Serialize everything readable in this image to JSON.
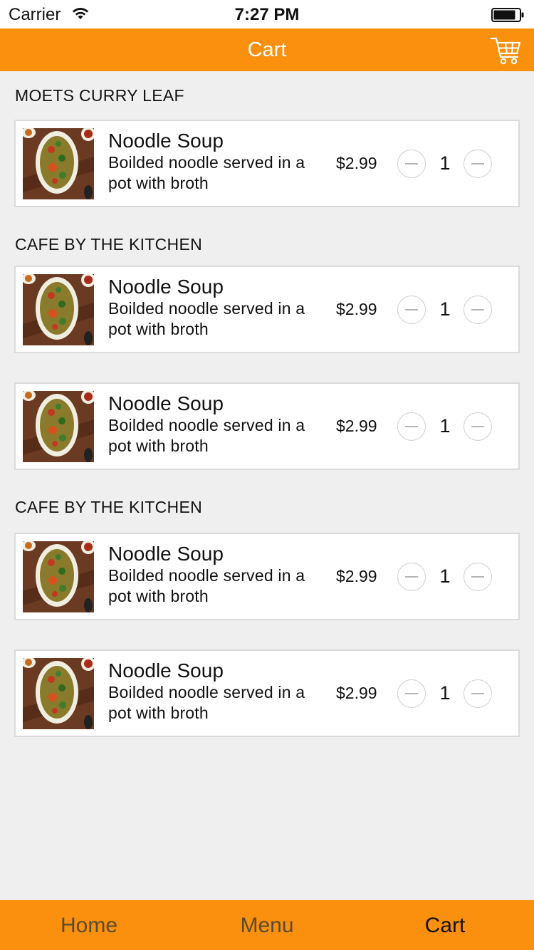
{
  "status_bar": {
    "carrier": "Carrier",
    "time": "7:27 PM"
  },
  "nav": {
    "title": "Cart",
    "cart_icon": "cart-icon"
  },
  "colors": {
    "accent": "#fa900e",
    "background": "#efefef"
  },
  "sections": [
    {
      "title": "MOETS CURRY LEAF",
      "items": [
        {
          "name": "Noodle Soup",
          "desc": "Boilded noodle served in a pot with broth",
          "price": "$2.99",
          "qty": "1"
        }
      ]
    },
    {
      "title": "CAFE BY THE KITCHEN",
      "items": [
        {
          "name": "Noodle Soup",
          "desc": "Boilded noodle served in a pot with broth",
          "price": "$2.99",
          "qty": "1"
        },
        {
          "name": "Noodle Soup",
          "desc": "Boilded noodle served in a pot with broth",
          "price": "$2.99",
          "qty": "1"
        }
      ]
    },
    {
      "title": "CAFE BY THE KITCHEN",
      "items": [
        {
          "name": "Noodle Soup",
          "desc": "Boilded noodle served in a pot with broth",
          "price": "$2.99",
          "qty": "1"
        },
        {
          "name": "Noodle Soup",
          "desc": "Boilded noodle served in a pot with broth",
          "price": "$2.99",
          "qty": "1"
        }
      ]
    }
  ],
  "tabs": [
    {
      "label": "Home",
      "active": false
    },
    {
      "label": "Menu",
      "active": false
    },
    {
      "label": "Cart",
      "active": true
    }
  ]
}
